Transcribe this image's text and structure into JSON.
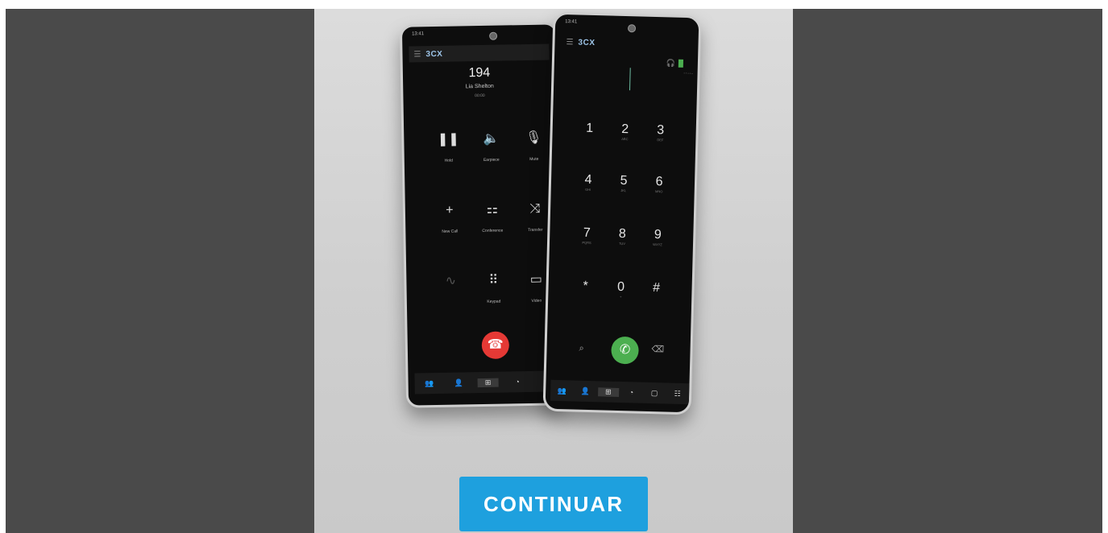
{
  "continue_label": "CONTINUAR",
  "phone_back": {
    "status_time": "13:41",
    "logo": "3CX",
    "call_number": "194",
    "caller_name": "Lia Shelton",
    "call_timer": "00:00",
    "controls": [
      {
        "icon": "pause-icon",
        "label": "Hold"
      },
      {
        "icon": "speaker-icon",
        "label": "Earpiece"
      },
      {
        "icon": "mic-icon",
        "label": "Mute"
      },
      {
        "icon": "plus-icon",
        "label": "New Call"
      },
      {
        "icon": "conference-icon",
        "label": "Conference"
      },
      {
        "icon": "transfer-icon",
        "label": "Transfer"
      },
      {
        "icon": "voice-icon",
        "label": ""
      },
      {
        "icon": "keypad-icon",
        "label": "Keypad"
      },
      {
        "icon": "video-icon",
        "label": "Video"
      }
    ]
  },
  "phone_front": {
    "status_time": "13:41",
    "logo": "3CX",
    "keys": [
      {
        "digit": "1",
        "sub": ""
      },
      {
        "digit": "2",
        "sub": "ABC"
      },
      {
        "digit": "3",
        "sub": "DEF"
      },
      {
        "digit": "4",
        "sub": "GHI"
      },
      {
        "digit": "5",
        "sub": "JKL"
      },
      {
        "digit": "6",
        "sub": "MNO"
      },
      {
        "digit": "7",
        "sub": "PQRS"
      },
      {
        "digit": "8",
        "sub": "TUV"
      },
      {
        "digit": "9",
        "sub": "WXYZ"
      },
      {
        "digit": "*",
        "sub": ""
      },
      {
        "digit": "0",
        "sub": "+"
      },
      {
        "digit": "#",
        "sub": ""
      }
    ]
  },
  "glyphs": {
    "menu": "☰",
    "pause": "❚❚",
    "speaker": "🔈",
    "mic": "🎙",
    "plus": "+",
    "conference": "⚏",
    "transfer": "⤨",
    "voice": "∿",
    "keypad": "⠿",
    "video": "▭",
    "hangup": "☎",
    "call": "✆",
    "search": "⌕",
    "backspace": "⌫",
    "headset": "🎧",
    "nav_people": "👥",
    "nav_contacts": "👤",
    "nav_keypad": "⊞",
    "nav_recents": "◔",
    "nav_chat": "▢",
    "nav_more": "☷"
  }
}
